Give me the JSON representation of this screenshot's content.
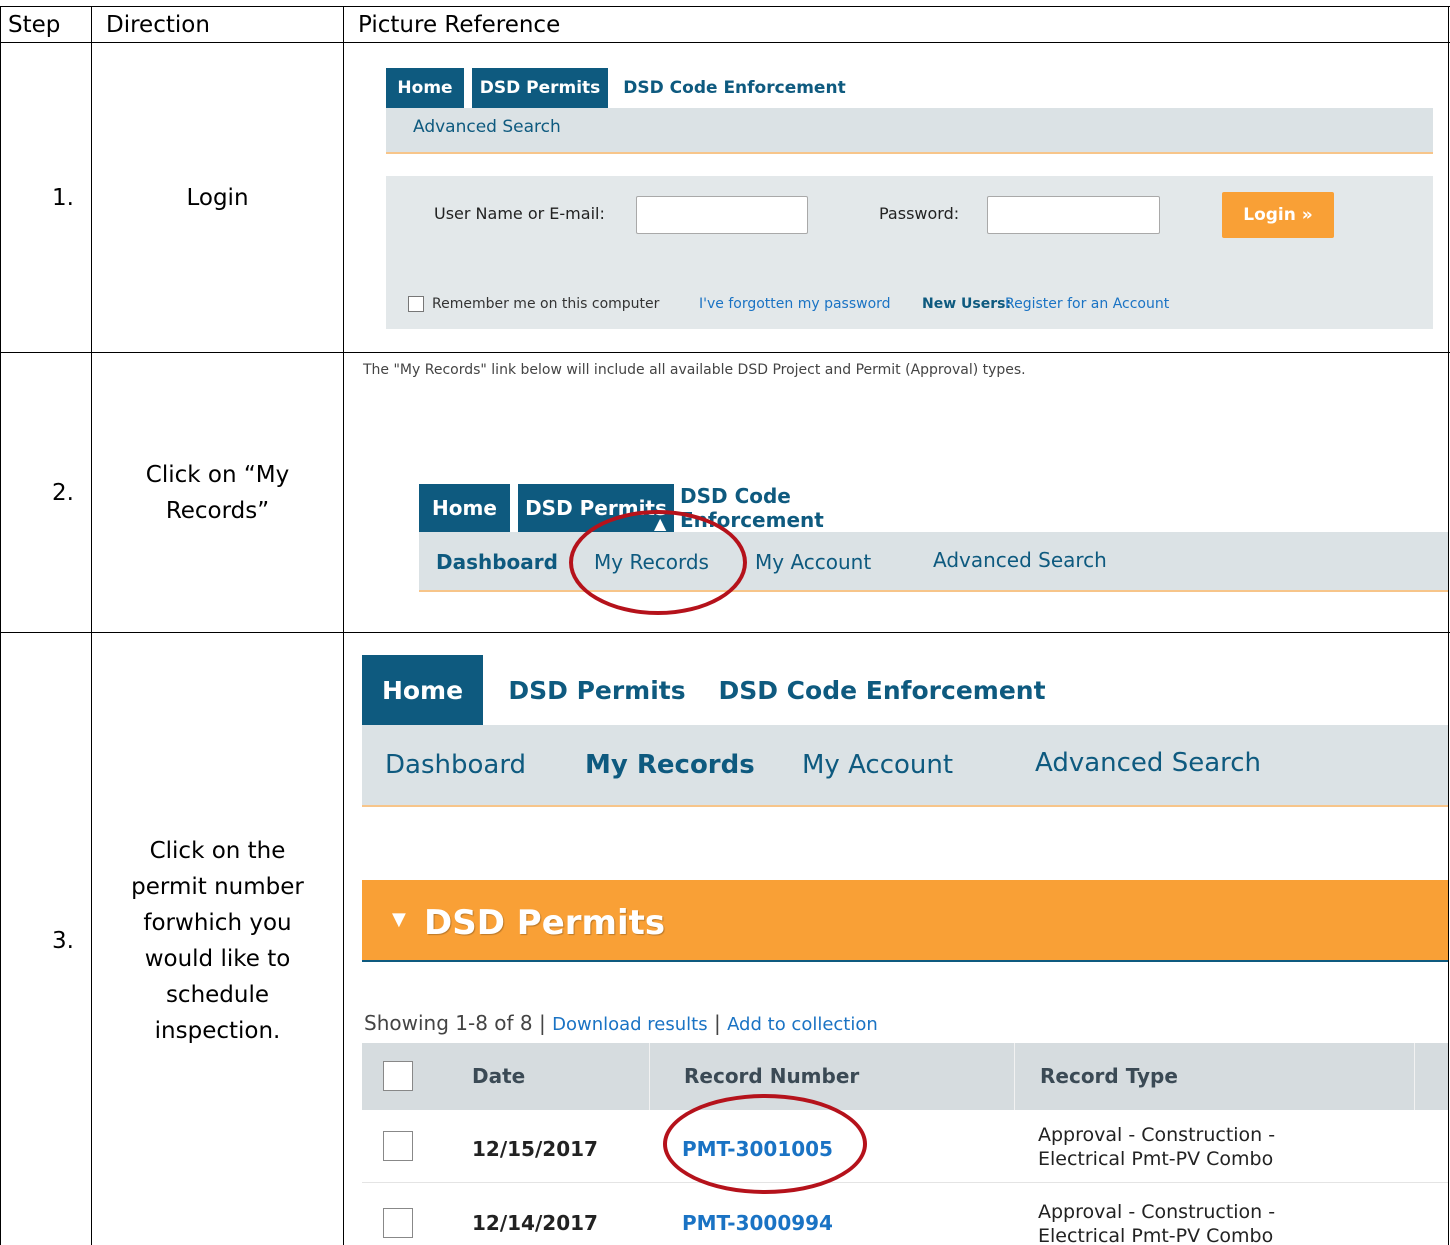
{
  "table": {
    "headers": {
      "step": "Step",
      "direction": "Direction",
      "picture": "Picture Reference"
    },
    "rows": [
      {
        "step": "1.",
        "direction": "Login"
      },
      {
        "step": "2.",
        "direction_line1": "Click on “My",
        "direction_line2": "Records”"
      },
      {
        "step": "3.",
        "direction_lines": [
          "Click on the",
          "permit number",
          "forwhich you",
          "would like to",
          "schedule",
          "inspection."
        ]
      }
    ]
  },
  "shot1": {
    "tabs": [
      "Home",
      "DSD Permits",
      "DSD Code Enforcement"
    ],
    "sublink": "Advanced Search",
    "username_label": "User Name or E-mail:",
    "password_label": "Password:",
    "login_button": "Login »",
    "remember_label": "Remember me on this computer",
    "forgot_link": "I've forgotten my password",
    "new_users_bold": "New Users:",
    "register_link": "Register for an Account"
  },
  "shot2": {
    "note": "The \"My Records\" link below will include all available DSD Project and Permit (Approval) types.",
    "tabs": [
      "Home",
      "DSD Permits",
      "DSD Code Enforcement"
    ],
    "sublinks": [
      "Dashboard",
      "My Records",
      "My Account",
      "Advanced Search"
    ]
  },
  "shot3": {
    "tabs": [
      "Home",
      "DSD Permits",
      "DSD Code Enforcement"
    ],
    "sublinks": [
      "Dashboard",
      "My Records",
      "My Account",
      "Advanced Search"
    ],
    "banner_title": "DSD Permits",
    "showing_text": "Showing 1-8 of 8 |",
    "download_link": "Download results",
    "separator": "|",
    "collection_link": "Add to collection",
    "columns": [
      "Date",
      "Record Number",
      "Record Type"
    ],
    "rows": [
      {
        "date": "12/15/2017",
        "record": "PMT-3001005",
        "type_line1": "Approval - Construction -",
        "type_line2": "Electrical Pmt-PV Combo"
      },
      {
        "date": "12/14/2017",
        "record": "PMT-3000994",
        "type_line1": "Approval - Construction -",
        "type_line2": "Electrical Pmt-PV Combo"
      }
    ]
  },
  "colors": {
    "nav_blue": "#0e5a7f",
    "accent_orange": "#f9a036",
    "link_blue": "#1a73c4",
    "annotation_red": "#b5121b"
  }
}
